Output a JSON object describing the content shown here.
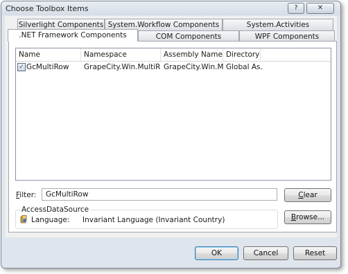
{
  "window": {
    "title": "Choose Toolbox Items",
    "help_glyph": "?",
    "close_glyph": "✕"
  },
  "tabs": {
    "row1": [
      "Silverlight Components",
      "System.Workflow Components",
      "System.Activities Components"
    ],
    "row2": [
      ".NET Framework Components",
      "COM Components",
      "WPF Components"
    ],
    "active": ".NET Framework Components"
  },
  "list": {
    "columns": [
      "Name",
      "Namespace",
      "Assembly Name",
      "Directory"
    ],
    "rows": [
      {
        "checked": true,
        "name": "GcMultiRow",
        "namespace": "GrapeCity.Win.MultiRow",
        "assembly": "GrapeCity.Win.Mul...",
        "directory": "Global As..."
      }
    ]
  },
  "filter": {
    "label_prefix": "",
    "label_access": "F",
    "label_rest": "ilter:",
    "value": "GcMultiRow"
  },
  "buttons": {
    "clear_access": "C",
    "clear_rest": "lear",
    "browse_access": "B",
    "browse_rest": "rowse...",
    "ok": "OK",
    "cancel": "Cancel",
    "reset": "Reset"
  },
  "details": {
    "group_title": "AccessDataSource",
    "language_label": "Language:",
    "language_value": "Invariant Language (Invariant Country)",
    "icon": "assembly-icon"
  },
  "colors": {
    "accent": "#3c7fb1",
    "window_bg": "#dfe5ec"
  }
}
